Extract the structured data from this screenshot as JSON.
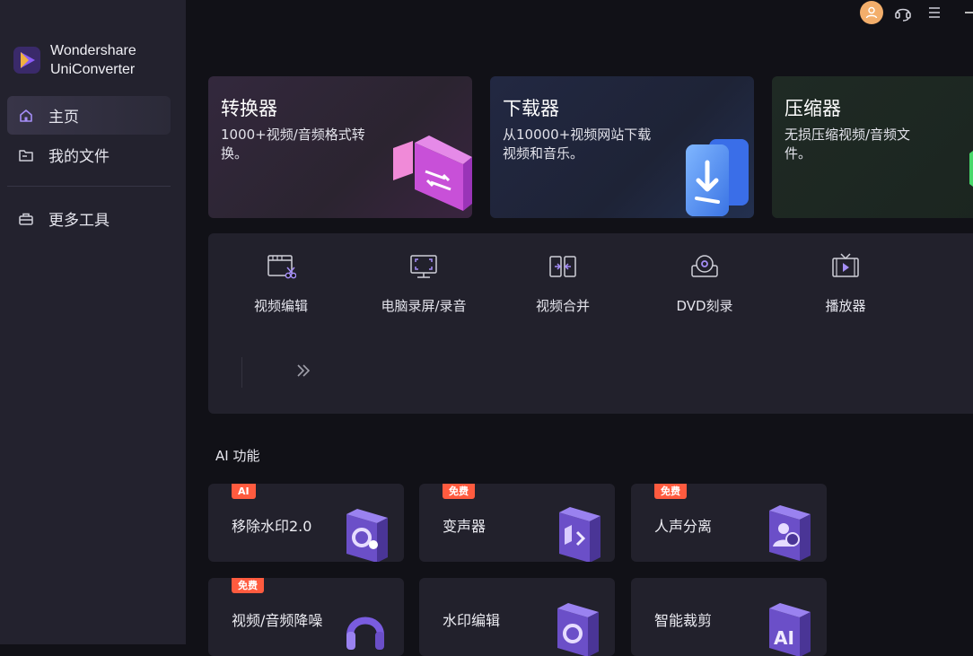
{
  "app": {
    "name_line1": "Wondershare",
    "name_line2": "UniConverter"
  },
  "sidebar": {
    "items": [
      {
        "label": "主页",
        "icon": "home-icon",
        "active": true
      },
      {
        "label": "我的文件",
        "icon": "folder-icon",
        "active": false
      },
      {
        "label": "更多工具",
        "icon": "toolbox-icon",
        "active": false
      }
    ]
  },
  "topbar": {
    "icons": [
      "avatar-icon",
      "headset-icon",
      "hamburger-menu-icon",
      "minimize-icon"
    ]
  },
  "hero_cards": [
    {
      "title": "转换器",
      "desc": "1000+视频/音频格式转换。",
      "icon": "converter-icon"
    },
    {
      "title": "下载器",
      "desc": "从10000+视频网站下载视频和音乐。",
      "icon": "downloader-icon"
    },
    {
      "title": "压缩器",
      "desc": "无损压缩视频/音频文件。",
      "icon": "compressor-icon"
    }
  ],
  "tools": [
    {
      "label": "视频编辑",
      "icon": "video-edit-icon"
    },
    {
      "label": "电脑录屏/录音",
      "icon": "screen-record-icon"
    },
    {
      "label": "视频合并",
      "icon": "video-merge-icon"
    },
    {
      "label": "DVD刻录",
      "icon": "dvd-burn-icon"
    },
    {
      "label": "播放器",
      "icon": "player-icon"
    }
  ],
  "ai_section": {
    "title": "AI 功能",
    "cards": [
      {
        "label": "移除水印2.0",
        "badge": "AI",
        "icon": "watermark-remove-icon"
      },
      {
        "label": "变声器",
        "badge": "免费",
        "icon": "voice-changer-icon"
      },
      {
        "label": "人声分离",
        "badge": "免费",
        "icon": "vocal-separate-icon"
      },
      {
        "label": "视频/音频降噪",
        "badge": "免费",
        "icon": "noise-reduce-icon"
      },
      {
        "label": "水印编辑",
        "badge": "",
        "icon": "watermark-edit-icon"
      },
      {
        "label": "智能裁剪",
        "badge": "",
        "icon": "smart-crop-icon"
      }
    ]
  },
  "colors": {
    "accent": "#8e5cf0",
    "badge": "#ff5b3f",
    "avatar": "#f3ae6b"
  }
}
